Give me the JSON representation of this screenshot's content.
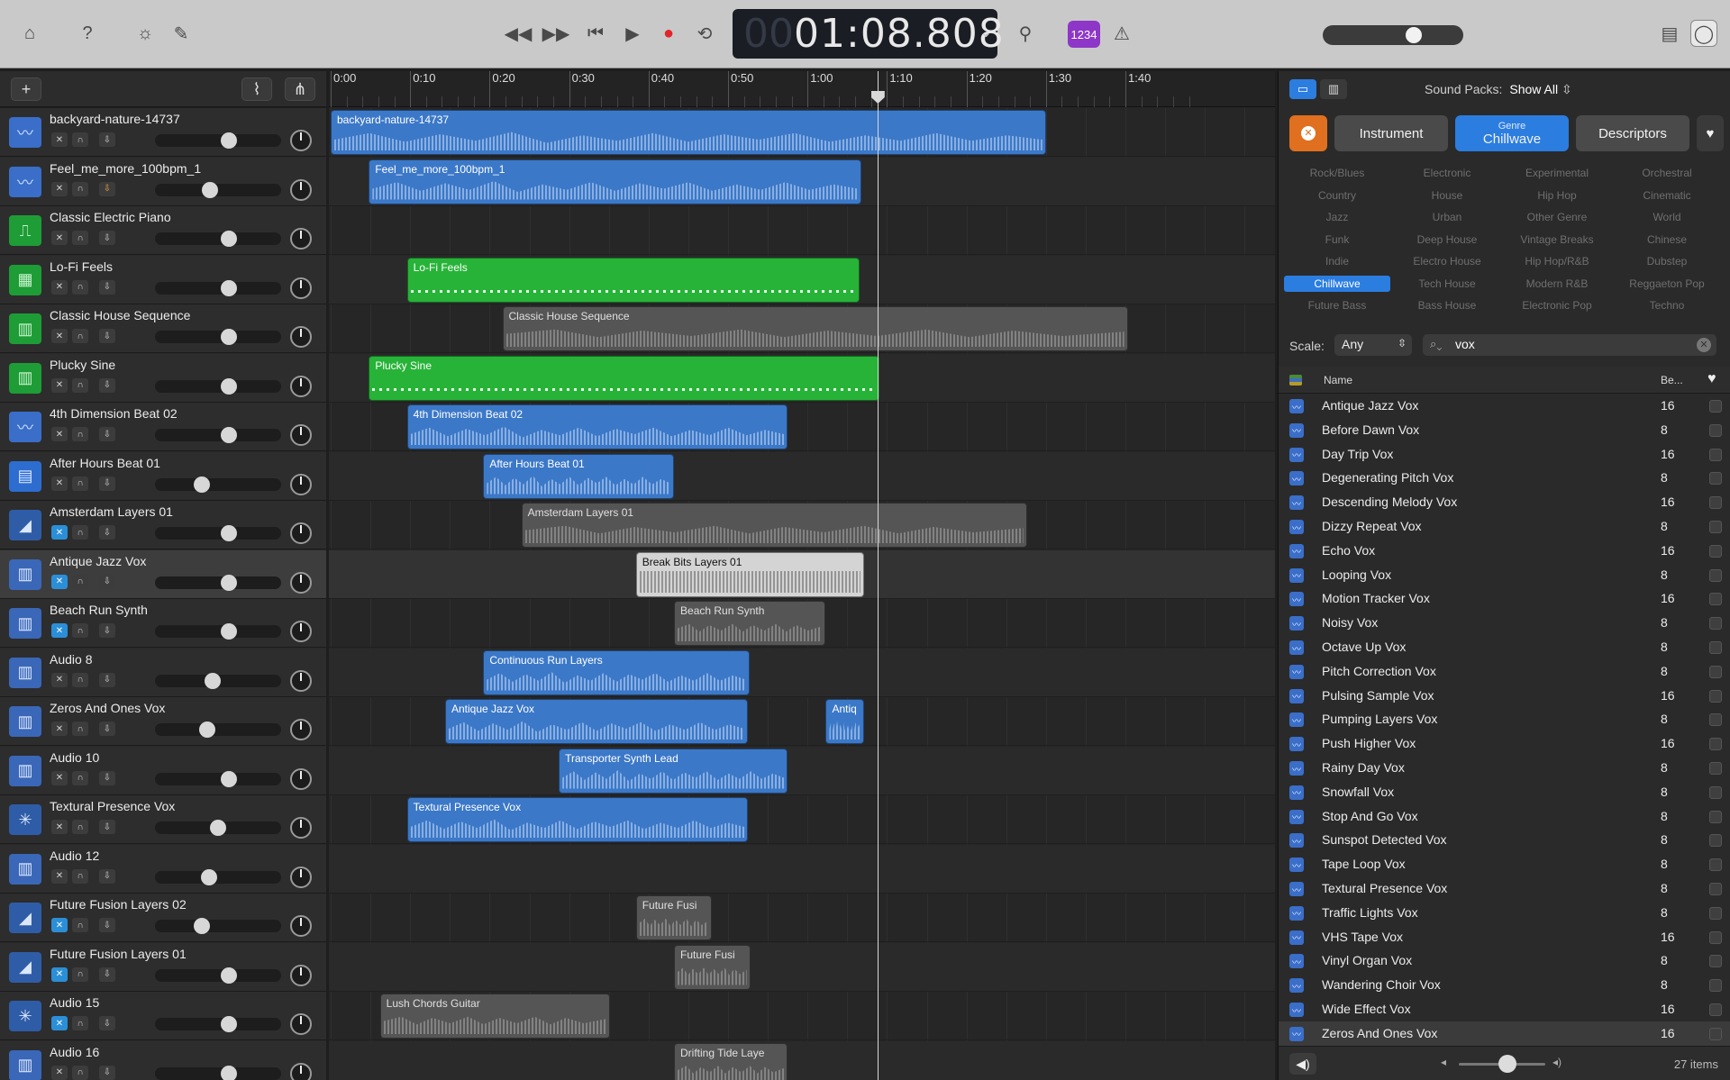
{
  "transport": {
    "lcd_dim": "00",
    "time": "01:08.808",
    "count_in_badge": "1234"
  },
  "ruler": {
    "labels": [
      "0:00",
      "0:10",
      "0:20",
      "0:30",
      "0:40",
      "0:50",
      "1:00",
      "1:10",
      "1:20",
      "1:30",
      "1:40"
    ]
  },
  "tracks": [
    {
      "name": "backyard-nature-14737",
      "icon": "audio-waveform-icon",
      "type": "audio",
      "fader": 0.6
    },
    {
      "name": "Feel_me_more_100bpm_1",
      "icon": "audio-waveform-icon",
      "type": "audio",
      "fader": 0.43,
      "rec_armed": true
    },
    {
      "name": "Classic Electric Piano",
      "icon": "electric-piano-icon",
      "type": "kbd",
      "fader": 0.6
    },
    {
      "name": "Lo-Fi Feels",
      "icon": "drum-machine-icon",
      "type": "kbd",
      "fader": 0.6
    },
    {
      "name": "Classic House Sequence",
      "icon": "synth-keyboard-icon",
      "type": "kbd",
      "fader": 0.6
    },
    {
      "name": "Plucky Sine",
      "icon": "synth-keyboard-icon",
      "type": "kbd",
      "fader": 0.6
    },
    {
      "name": "4th Dimension Beat 02",
      "icon": "audio-waveform-icon",
      "type": "audio",
      "fader": 0.6
    },
    {
      "name": "After Hours Beat 01",
      "icon": "beat-grid-icon",
      "type": "drum",
      "fader": 0.35
    },
    {
      "name": "Amsterdam Layers 01",
      "icon": "speaker-icon",
      "type": "spk",
      "fader": 0.6,
      "mute_active": true
    },
    {
      "name": "Antique Jazz Vox",
      "icon": "piano-keys-icon",
      "type": "blue2",
      "fader": 0.6,
      "mute_active": true
    },
    {
      "name": "Beach Run Synth",
      "icon": "piano-keys-icon",
      "type": "blue2",
      "fader": 0.6,
      "mute_active": true
    },
    {
      "name": "Audio 8",
      "icon": "piano-keys-icon",
      "type": "blue2",
      "fader": 0.45
    },
    {
      "name": "Zeros And Ones Vox",
      "icon": "piano-keys-icon",
      "type": "blue2",
      "fader": 0.4
    },
    {
      "name": "Audio 10",
      "icon": "piano-keys-icon",
      "type": "blue2",
      "fader": 0.6
    },
    {
      "name": "Textural Presence Vox",
      "icon": "sparkle-icon",
      "type": "spk",
      "fader": 0.5
    },
    {
      "name": "Audio 12",
      "icon": "piano-keys-icon",
      "type": "blue2",
      "fader": 0.42
    },
    {
      "name": "Future Fusion Layers 02",
      "icon": "speaker-icon",
      "type": "spk",
      "fader": 0.35,
      "mute_active": true
    },
    {
      "name": "Future Fusion Layers 01",
      "icon": "speaker-icon",
      "type": "spk",
      "fader": 0.6,
      "mute_active": true
    },
    {
      "name": "Audio 15",
      "icon": "sparkle-icon",
      "type": "spk",
      "fader": 0.6,
      "mute_active": true
    },
    {
      "name": "Audio 16",
      "icon": "piano-keys-icon",
      "type": "blue2",
      "fader": 0.6
    }
  ],
  "regions": [
    {
      "track": 0,
      "name": "backyard-nature-14737",
      "color": "blue",
      "start": 0,
      "end": 90
    },
    {
      "track": 1,
      "name": "Feel_me_more_100bpm_1",
      "color": "blue",
      "start": 4.8,
      "end": 66.8
    },
    {
      "track": 3,
      "name": "Lo-Fi Feels",
      "color": "green",
      "start": 9.6,
      "end": 66.5
    },
    {
      "track": 4,
      "name": "Classic House Sequence",
      "color": "gray",
      "start": 21.6,
      "end": 100.3
    },
    {
      "track": 5,
      "name": "Plucky Sine",
      "color": "green",
      "start": 4.8,
      "end": 69.1
    },
    {
      "track": 6,
      "name": "4th Dimension Beat 02",
      "color": "blue",
      "start": 9.6,
      "end": 57.5
    },
    {
      "track": 7,
      "name": "After Hours Beat 01",
      "color": "blue",
      "start": 19.2,
      "end": 43.2
    },
    {
      "track": 8,
      "name": "Amsterdam Layers 01",
      "color": "gray",
      "start": 24,
      "end": 87.6
    },
    {
      "track": 9,
      "name": "Break Bits Layers 01",
      "color": "light",
      "start": 38.4,
      "end": 67.1
    },
    {
      "track": 10,
      "name": "Beach Run Synth",
      "color": "gray",
      "start": 43.2,
      "end": 62.3
    },
    {
      "track": 11,
      "name": "Continuous Run Layers",
      "color": "blue",
      "start": 19.2,
      "end": 52.7
    },
    {
      "track": 12,
      "name": "Antique Jazz Vox",
      "color": "blue",
      "start": 14.4,
      "end": 52.5
    },
    {
      "track": 12,
      "name": "Antiq",
      "color": "blue",
      "start": 62.3,
      "end": 67.1
    },
    {
      "track": 13,
      "name": "Transporter Synth Lead",
      "color": "blue",
      "start": 28.7,
      "end": 57.5
    },
    {
      "track": 14,
      "name": "Textural Presence Vox",
      "color": "blue",
      "start": 9.6,
      "end": 52.5
    },
    {
      "track": 16,
      "name": "Future Fusi",
      "color": "gray",
      "start": 38.4,
      "end": 48
    },
    {
      "track": 17,
      "name": "Future Fusi",
      "color": "gray",
      "start": 43.2,
      "end": 52.8
    },
    {
      "track": 18,
      "name": "Lush Chords Guitar",
      "color": "gray",
      "start": 6.2,
      "end": 35.1
    },
    {
      "track": 19,
      "name": "Drifting Tide Laye",
      "color": "gray",
      "start": 43.2,
      "end": 57.5
    }
  ],
  "playhead_seconds": 68.8,
  "browser": {
    "sound_packs_label": "Sound Packs:",
    "sound_packs_value": "Show All",
    "instrument_label": "Instrument",
    "genre_sub": "Genre",
    "genre_label": "Chillwave",
    "descriptors_label": "Descriptors",
    "keywords": [
      "Rock/Blues",
      "Electronic",
      "Experimental",
      "Orchestral",
      "Country",
      "House",
      "Hip Hop",
      "Cinematic",
      "Jazz",
      "Urban",
      "Other Genre",
      "World",
      "Funk",
      "Deep House",
      "Vintage Breaks",
      "Chinese",
      "Indie",
      "Electro House",
      "Hip Hop/R&B",
      "Dubstep",
      "Chillwave",
      "Tech House",
      "Modern R&B",
      "Reggaeton Pop",
      "Future Bass",
      "Bass House",
      "Electronic Pop",
      "Techno"
    ],
    "selected_keyword": "Chillwave",
    "scale_label": "Scale:",
    "scale_value": "Any",
    "search_value": "vox",
    "col_name": "Name",
    "col_beats": "Be...",
    "results": [
      {
        "name": "Antique Jazz Vox",
        "beats": "16"
      },
      {
        "name": "Before Dawn Vox",
        "beats": "8"
      },
      {
        "name": "Day Trip Vox",
        "beats": "16"
      },
      {
        "name": "Degenerating Pitch Vox",
        "beats": "8"
      },
      {
        "name": "Descending Melody Vox",
        "beats": "16"
      },
      {
        "name": "Dizzy Repeat Vox",
        "beats": "8"
      },
      {
        "name": "Echo Vox",
        "beats": "16"
      },
      {
        "name": "Looping Vox",
        "beats": "8"
      },
      {
        "name": "Motion Tracker Vox",
        "beats": "16"
      },
      {
        "name": "Noisy Vox",
        "beats": "8"
      },
      {
        "name": "Octave Up Vox",
        "beats": "8"
      },
      {
        "name": "Pitch Correction Vox",
        "beats": "8"
      },
      {
        "name": "Pulsing Sample Vox",
        "beats": "16"
      },
      {
        "name": "Pumping Layers Vox",
        "beats": "8"
      },
      {
        "name": "Push Higher Vox",
        "beats": "16"
      },
      {
        "name": "Rainy Day Vox",
        "beats": "8"
      },
      {
        "name": "Snowfall Vox",
        "beats": "8"
      },
      {
        "name": "Stop And Go Vox",
        "beats": "8"
      },
      {
        "name": "Sunspot Detected Vox",
        "beats": "8"
      },
      {
        "name": "Tape Loop Vox",
        "beats": "8"
      },
      {
        "name": "Textural Presence Vox",
        "beats": "8"
      },
      {
        "name": "Traffic Lights Vox",
        "beats": "8"
      },
      {
        "name": "VHS Tape Vox",
        "beats": "16"
      },
      {
        "name": "Vinyl Organ Vox",
        "beats": "8"
      },
      {
        "name": "Wandering Choir Vox",
        "beats": "8"
      },
      {
        "name": "Wide Effect Vox",
        "beats": "16"
      },
      {
        "name": "Zeros And Ones Vox",
        "beats": "16"
      }
    ],
    "selected_result": 26,
    "items_count": "27 items"
  }
}
